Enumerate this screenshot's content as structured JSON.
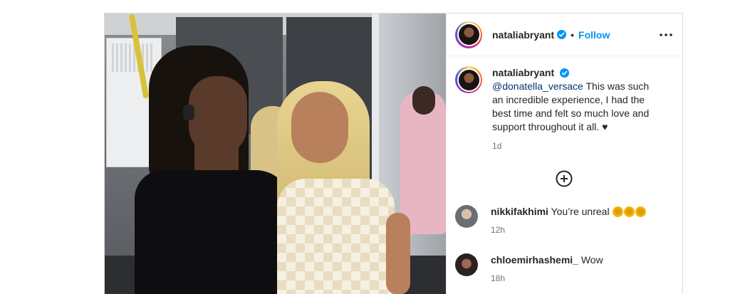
{
  "post": {
    "author": "nataliabryant",
    "follow_label": "Follow",
    "separator": "•"
  },
  "caption": {
    "user": "nataliabryant",
    "mention": "@donatella_versace",
    "text": "This was such an incredible experience, I had the best time and felt so much love and support throughout it all. ♥",
    "time": "1d"
  },
  "comments": [
    {
      "user": "nikkifakhimi",
      "text": "You’re unreal",
      "emoji": [
        "clapping-hands",
        "clapping-hands",
        "clapping-hands"
      ],
      "time": "12h"
    },
    {
      "user": "chloemirhashemi_",
      "text": "Wow",
      "time": "18h"
    }
  ],
  "icons": {
    "verified": "verified-badge-icon",
    "more": "more-options-icon",
    "load_more": "plus-circle-icon"
  },
  "colors": {
    "follow": "#0095f6",
    "verified": "#0095f6",
    "mention": "#00376b"
  }
}
